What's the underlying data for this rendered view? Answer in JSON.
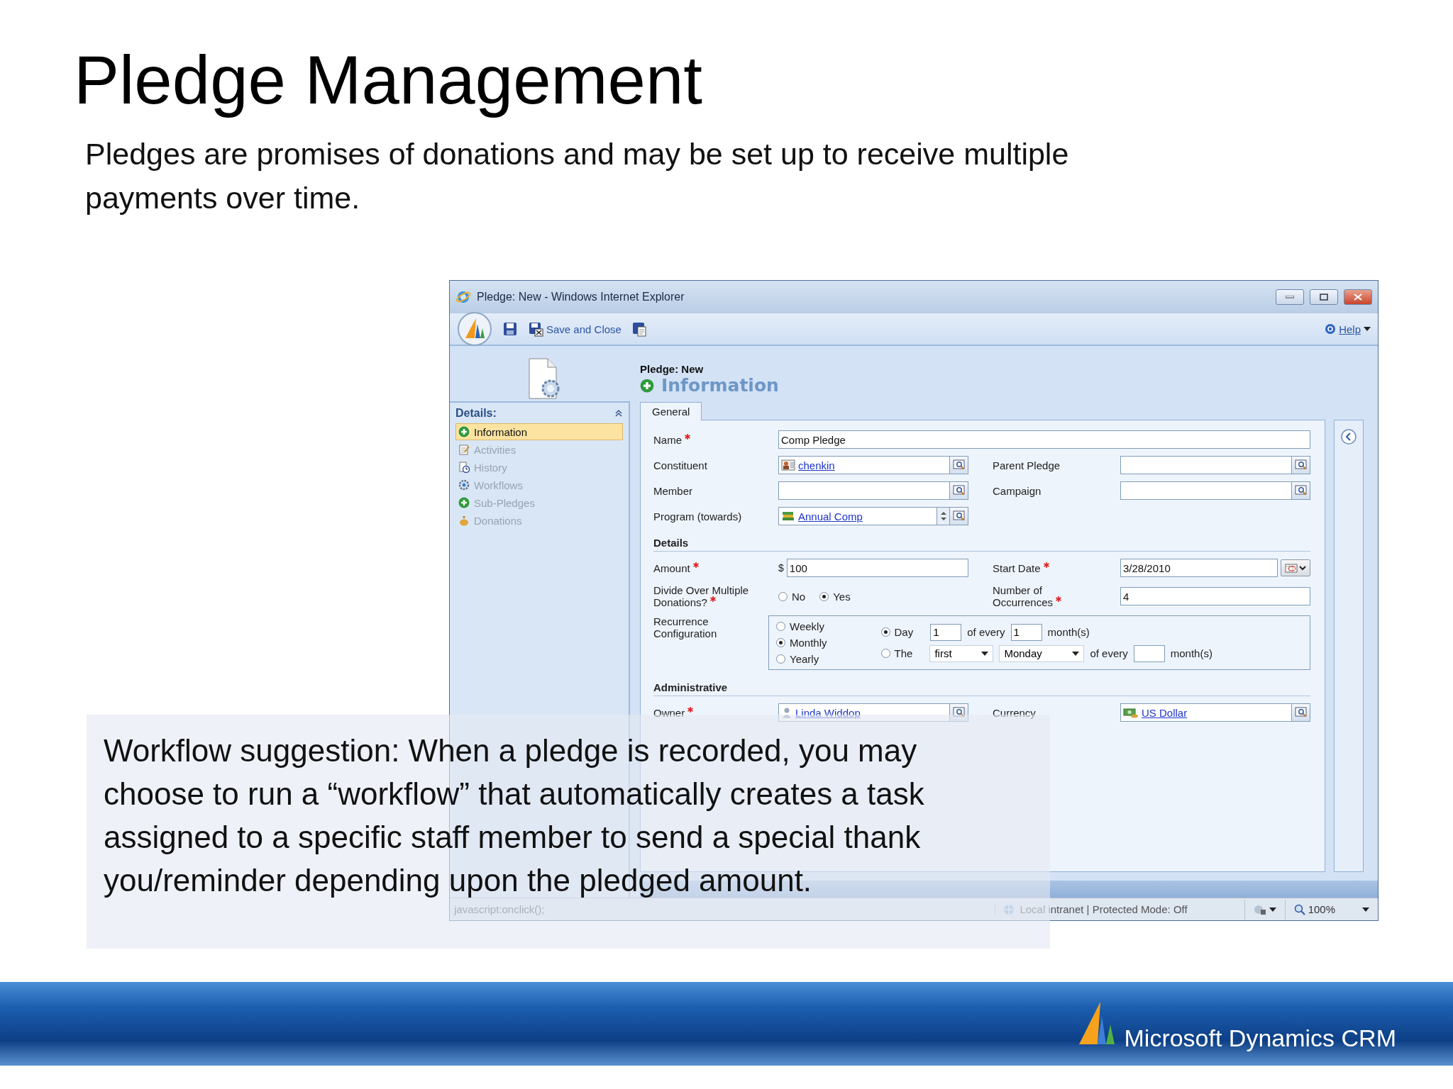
{
  "slide": {
    "title": "Pledge Management",
    "subtitle": "Pledges are promises of donations and may be set up to receive multiple payments over time."
  },
  "window": {
    "title": "Pledge: New - Windows Internet Explorer"
  },
  "toolbar": {
    "save_and_close": "Save and Close",
    "help": "Help"
  },
  "form_header": {
    "entity": "Pledge: New",
    "section": "Information"
  },
  "sidebar": {
    "heading": "Details:",
    "items": [
      {
        "label": "Information",
        "selected": true
      },
      {
        "label": "Activities",
        "selected": false
      },
      {
        "label": "History",
        "selected": false
      },
      {
        "label": "Workflows",
        "selected": false
      },
      {
        "label": "Sub-Pledges",
        "selected": false
      },
      {
        "label": "Donations",
        "selected": false
      }
    ]
  },
  "tabs": [
    {
      "label": "General",
      "selected": true
    }
  ],
  "general": {
    "name": {
      "label": "Name",
      "required": true,
      "value": "Comp Pledge"
    },
    "constituent": {
      "label": "Constituent",
      "required": false,
      "value": "chenkin"
    },
    "parent_pledge": {
      "label": "Parent Pledge",
      "required": false
    },
    "member": {
      "label": "Member",
      "required": false
    },
    "campaign": {
      "label": "Campaign",
      "required": false
    },
    "program": {
      "label": "Program (towards)",
      "required": false,
      "value": "Annual Comp"
    }
  },
  "details": {
    "heading": "Details",
    "amount": {
      "label": "Amount",
      "required": true,
      "currency": "$",
      "value": "100"
    },
    "start_date": {
      "label": "Start Date",
      "required": true,
      "value": "3/28/2010"
    },
    "divide": {
      "label": "Divide Over Multiple Donations?",
      "required": true,
      "options": [
        {
          "label": "No",
          "selected": false
        },
        {
          "label": "Yes",
          "selected": true
        }
      ]
    },
    "occurrences": {
      "label": "Number of Occurrences",
      "required": true,
      "value": "4"
    },
    "recurrence": {
      "label": "Recurrence Configuration",
      "patterns": [
        {
          "label": "Weekly",
          "selected": false
        },
        {
          "label": "Monthly",
          "selected": true
        },
        {
          "label": "Yearly",
          "selected": false
        }
      ],
      "day_option": {
        "label": "Day",
        "selected": true,
        "day": "1",
        "of_every": "of every",
        "months": "1",
        "unit": "month(s)"
      },
      "the_option": {
        "label": "The",
        "selected": false,
        "ordinal": "first",
        "weekday": "Monday",
        "of_every": "of every",
        "unit": "month(s)"
      }
    }
  },
  "administrative": {
    "heading": "Administrative",
    "owner": {
      "label": "Owner",
      "required": true,
      "value": "Linda Widdop"
    },
    "currency": {
      "label": "Currency",
      "required": false,
      "value": "US Dollar"
    }
  },
  "status_bar": {
    "url": "javascript:onclick();",
    "zone": "Local intranet | Protected Mode: Off",
    "zoom": "100%"
  },
  "callout": {
    "text": "Workflow suggestion: When a pledge is recorded, you may choose to run a “workflow” that automatically creates a task assigned to a specific staff member to send a special thank you/reminder depending upon the pledged amount."
  },
  "footer": {
    "brand": "Microsoft Dynamics CRM"
  }
}
